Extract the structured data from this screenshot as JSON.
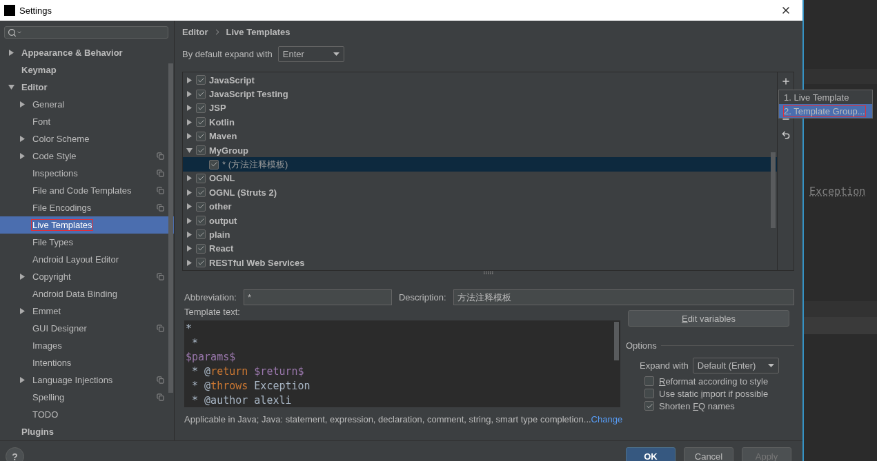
{
  "window": {
    "title": "Settings"
  },
  "sidebar": {
    "items": [
      {
        "label": "Appearance & Behavior",
        "expanded": false,
        "selected": false,
        "annotated": false,
        "project_scope": false
      },
      {
        "label": "Keymap",
        "selected": false,
        "annotated": false,
        "project_scope": false
      },
      {
        "label": "Editor",
        "expanded": true,
        "selected": false,
        "annotated": false,
        "project_scope": false,
        "children": [
          {
            "label": "General",
            "expanded": false,
            "selected": false,
            "annotated": false,
            "project_scope": false
          },
          {
            "label": "Font",
            "selected": false,
            "annotated": false,
            "project_scope": false
          },
          {
            "label": "Color Scheme",
            "expanded": false,
            "selected": false,
            "annotated": false,
            "project_scope": false
          },
          {
            "label": "Code Style",
            "expanded": false,
            "selected": false,
            "annotated": false,
            "project_scope": true
          },
          {
            "label": "Inspections",
            "selected": false,
            "annotated": false,
            "project_scope": true
          },
          {
            "label": "File and Code Templates",
            "selected": false,
            "annotated": false,
            "project_scope": true
          },
          {
            "label": "File Encodings",
            "selected": false,
            "annotated": false,
            "project_scope": true
          },
          {
            "label": "Live Templates",
            "selected": true,
            "annotated": true,
            "project_scope": false
          },
          {
            "label": "File Types",
            "selected": false,
            "annotated": false,
            "project_scope": false
          },
          {
            "label": "Android Layout Editor",
            "selected": false,
            "annotated": false,
            "project_scope": false
          },
          {
            "label": "Copyright",
            "expanded": false,
            "selected": false,
            "annotated": false,
            "project_scope": true
          },
          {
            "label": "Android Data Binding",
            "selected": false,
            "annotated": false,
            "project_scope": false
          },
          {
            "label": "Emmet",
            "expanded": false,
            "selected": false,
            "annotated": false,
            "project_scope": false
          },
          {
            "label": "GUI Designer",
            "selected": false,
            "annotated": false,
            "project_scope": true
          },
          {
            "label": "Images",
            "selected": false,
            "annotated": false,
            "project_scope": false
          },
          {
            "label": "Intentions",
            "selected": false,
            "annotated": false,
            "project_scope": false
          },
          {
            "label": "Language Injections",
            "expanded": false,
            "selected": false,
            "annotated": false,
            "project_scope": true
          },
          {
            "label": "Spelling",
            "selected": false,
            "annotated": false,
            "project_scope": true
          },
          {
            "label": "TODO",
            "selected": false,
            "annotated": false,
            "project_scope": false
          }
        ]
      },
      {
        "label": "Plugins",
        "selected": false,
        "annotated": false,
        "project_scope": false
      }
    ]
  },
  "breadcrumb": [
    "Editor",
    "Live Templates"
  ],
  "expand_default": {
    "label": "By default expand with",
    "value": "Enter"
  },
  "template_groups": [
    {
      "label": "JavaScript",
      "expanded": false,
      "checked": true,
      "selected": false
    },
    {
      "label": "JavaScript Testing",
      "expanded": false,
      "checked": true,
      "selected": false
    },
    {
      "label": "JSP",
      "expanded": false,
      "checked": true,
      "selected": false
    },
    {
      "label": "Kotlin",
      "expanded": false,
      "checked": true,
      "selected": false
    },
    {
      "label": "Maven",
      "expanded": false,
      "checked": true,
      "selected": false
    },
    {
      "label": "MyGroup",
      "expanded": true,
      "checked": true,
      "selected": false,
      "children": [
        {
          "label": "* (方法注释模板)",
          "checked": true,
          "selected": true
        }
      ]
    },
    {
      "label": "OGNL",
      "expanded": false,
      "checked": true,
      "selected": false
    },
    {
      "label": "OGNL (Struts 2)",
      "expanded": false,
      "checked": true,
      "selected": false
    },
    {
      "label": "other",
      "expanded": false,
      "checked": true,
      "selected": false
    },
    {
      "label": "output",
      "expanded": false,
      "checked": true,
      "selected": false
    },
    {
      "label": "plain",
      "expanded": false,
      "checked": true,
      "selected": false
    },
    {
      "label": "React",
      "expanded": false,
      "checked": true,
      "selected": false
    },
    {
      "label": "RESTful Web Services",
      "expanded": false,
      "checked": true,
      "selected": false
    }
  ],
  "add_menu": [
    {
      "label": "1. Live Template",
      "selected": false,
      "annotated": false
    },
    {
      "label": "2. Template Group...",
      "selected": true,
      "annotated": true
    }
  ],
  "abbreviation": {
    "label": "Abbreviation:",
    "value": "*"
  },
  "description": {
    "label": "Description:",
    "value": "方法注释模板"
  },
  "template_text": {
    "label": "Template text:",
    "lines": [
      [
        {
          "text": "*",
          "kind": "plain"
        }
      ],
      [
        {
          "text": " *",
          "kind": "plain"
        }
      ],
      [
        {
          "text": "$params$",
          "kind": "variable"
        }
      ],
      [
        {
          "text": " * @",
          "kind": "plain"
        },
        {
          "text": "return",
          "kind": "tag"
        },
        {
          "text": " $return$",
          "kind": "variable"
        }
      ],
      [
        {
          "text": " * @",
          "kind": "plain"
        },
        {
          "text": "throws",
          "kind": "tag"
        },
        {
          "text": " Exception",
          "kind": "plain"
        }
      ],
      [
        {
          "text": " * @author alexli",
          "kind": "plain"
        }
      ]
    ]
  },
  "applicable": {
    "text": "Applicable in Java; Java: statement, expression, declaration, comment, string, smart type completion...",
    "link": "Change"
  },
  "edit_variables": {
    "parts": {
      "key": "E",
      "after": "dit variables"
    }
  },
  "options": {
    "title": "Options",
    "expand_with": {
      "label": "Expand with",
      "value": "Default (Enter)"
    },
    "checkboxes": [
      {
        "parts": {
          "key": "R",
          "after": "eformat according to style"
        },
        "checked": false
      },
      {
        "parts": {
          "before": "Use static ",
          "key": "i",
          "after": "mport if possible"
        },
        "checked": false
      },
      {
        "parts": {
          "before": "Shorten ",
          "key": "F",
          "after": "Q names"
        },
        "checked": true
      }
    ]
  },
  "help": "?",
  "buttons": [
    {
      "label": "OK",
      "primary": true,
      "disabled": false
    },
    {
      "label": "Cancel",
      "primary": false,
      "disabled": false
    },
    {
      "label": "Apply",
      "primary": false,
      "disabled": true
    }
  ],
  "background_editor": {
    "text": "Exception"
  }
}
